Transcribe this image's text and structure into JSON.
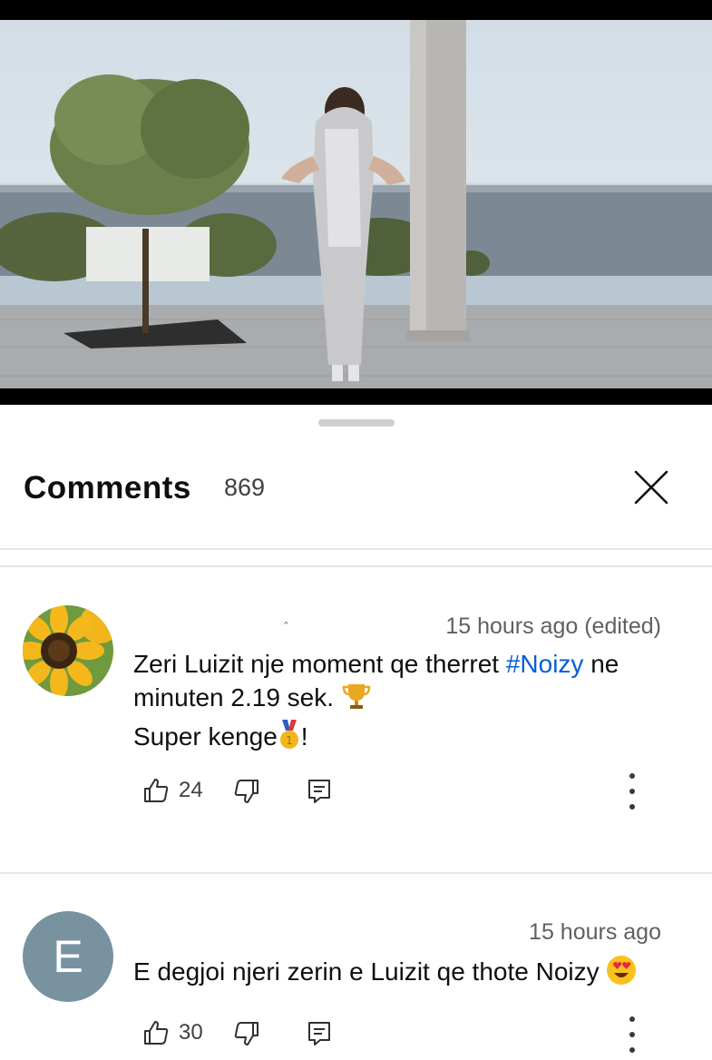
{
  "video": {
    "scene": "person in silver hooded dress standing on seaside terrace"
  },
  "sheet": {
    "title": "Comments",
    "count": "869",
    "close_icon": "close-icon"
  },
  "comments": [
    {
      "avatar": "sunflower-avatar",
      "meta": "15 hours ago (edited)",
      "line1_a": "Zeri Luizit nje moment  qe therret ",
      "hashtag": "#Noizy",
      "line1_b": " ne",
      "line2": "minuten 2.19 sek. ",
      "line3": "Super kenge",
      "line3_end": "!",
      "likes": "24"
    },
    {
      "avatar_letter": "E",
      "meta": "15 hours ago",
      "text": "E degjoi njeri zerin e Luizit qe thote Noizy ",
      "likes": "30"
    }
  ],
  "colors": {
    "hashtag": "#065fd4",
    "avatar_e": "#7892a0"
  }
}
